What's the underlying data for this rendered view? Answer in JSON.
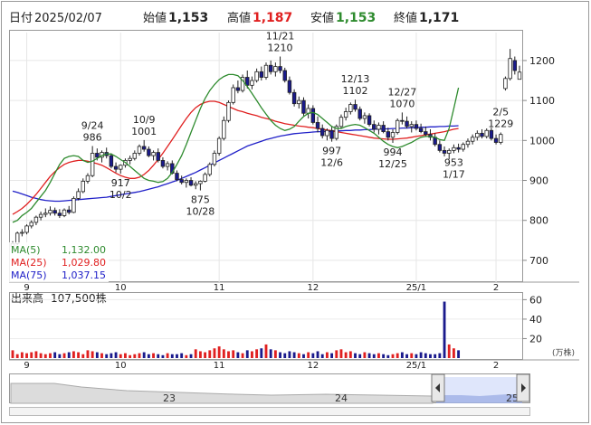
{
  "header": {
    "date_label": "日付",
    "date": "2025/02/07",
    "open_label": "始値",
    "open": "1,153",
    "high_label": "高値",
    "high": "1,187",
    "low_label": "安値",
    "low": "1,153",
    "close_label": "終値",
    "close": "1,171"
  },
  "colors": {
    "up_candle": "#ffffff",
    "down_candle": "#1a1a8c",
    "ma5": "#2e8b2e",
    "ma25": "#e02020",
    "ma75": "#2020c8",
    "volume_up": "#e02020",
    "volume_down": "#1a1a8c",
    "high_text": "#e02020",
    "low_text": "#2e8b2e"
  },
  "ma_legend": [
    {
      "label": "MA(5)",
      "value": "1,132.00",
      "color": "#2e8b2e"
    },
    {
      "label": "MA(25)",
      "value": "1,029.80",
      "color": "#e02020"
    },
    {
      "label": "MA(75)",
      "value": "1,037.15",
      "color": "#2020c8"
    }
  ],
  "volume_label": "出来高",
  "volume_value": "107,500株",
  "volume_unit": "(万株)",
  "annotations": [
    {
      "date": "9/24",
      "price": "986"
    },
    {
      "date": "10/9",
      "price": "1001"
    },
    {
      "date": "10/2",
      "price": "917"
    },
    {
      "date": "10/28",
      "price": "875"
    },
    {
      "date": "11/21",
      "price": "1210"
    },
    {
      "date": "12/6",
      "price": "997"
    },
    {
      "date": "12/13",
      "price": "1102"
    },
    {
      "date": "12/25",
      "price": "994"
    },
    {
      "date": "12/27",
      "price": "1070"
    },
    {
      "date": "1/17",
      "price": "953"
    },
    {
      "date": "2/5",
      "price": "1229"
    }
  ],
  "navigator": {
    "labels": [
      "23",
      "24",
      "25"
    ],
    "left_handle": "left-arrow",
    "right_handle": "right-arrow"
  },
  "chart_data": {
    "type": "candlestick",
    "x_tick_labels": [
      "9",
      "10",
      "11",
      "12",
      "25/1",
      "2"
    ],
    "price_ticks": [
      700,
      800,
      900,
      1000,
      1100,
      1200
    ],
    "price_range": [
      650,
      1270
    ],
    "volume_ticks": [
      20,
      40,
      60
    ],
    "volume_range": [
      0,
      65
    ],
    "candles": [
      {
        "d": "8/28",
        "o": 735,
        "h": 748,
        "l": 720,
        "c": 742
      },
      {
        "d": "8/29",
        "o": 742,
        "h": 772,
        "l": 738,
        "c": 768
      },
      {
        "d": "8/30",
        "o": 768,
        "h": 778,
        "l": 760,
        "c": 770
      },
      {
        "d": "9/2",
        "o": 770,
        "h": 790,
        "l": 765,
        "c": 786
      },
      {
        "d": "9/3",
        "o": 786,
        "h": 800,
        "l": 780,
        "c": 795
      },
      {
        "d": "9/4",
        "o": 795,
        "h": 812,
        "l": 788,
        "c": 808
      },
      {
        "d": "9/5",
        "o": 808,
        "h": 822,
        "l": 800,
        "c": 815
      },
      {
        "d": "9/6",
        "o": 815,
        "h": 830,
        "l": 808,
        "c": 818
      },
      {
        "d": "9/9",
        "o": 818,
        "h": 835,
        "l": 812,
        "c": 825
      },
      {
        "d": "9/10",
        "o": 825,
        "h": 832,
        "l": 812,
        "c": 818
      },
      {
        "d": "9/11",
        "o": 818,
        "h": 828,
        "l": 806,
        "c": 812
      },
      {
        "d": "9/12",
        "o": 812,
        "h": 830,
        "l": 808,
        "c": 826
      },
      {
        "d": "9/13",
        "o": 826,
        "h": 836,
        "l": 815,
        "c": 820
      },
      {
        "d": "9/17",
        "o": 820,
        "h": 860,
        "l": 818,
        "c": 855
      },
      {
        "d": "9/18",
        "o": 855,
        "h": 880,
        "l": 850,
        "c": 872
      },
      {
        "d": "9/19",
        "o": 872,
        "h": 905,
        "l": 868,
        "c": 898
      },
      {
        "d": "9/20",
        "o": 898,
        "h": 918,
        "l": 892,
        "c": 912
      },
      {
        "d": "9/24",
        "o": 912,
        "h": 986,
        "l": 908,
        "c": 968
      },
      {
        "d": "9/25",
        "o": 968,
        "h": 980,
        "l": 950,
        "c": 958
      },
      {
        "d": "9/26",
        "o": 958,
        "h": 975,
        "l": 945,
        "c": 970
      },
      {
        "d": "9/27",
        "o": 970,
        "h": 982,
        "l": 955,
        "c": 962
      },
      {
        "d": "9/30",
        "o": 962,
        "h": 968,
        "l": 930,
        "c": 935
      },
      {
        "d": "10/1",
        "o": 935,
        "h": 945,
        "l": 920,
        "c": 928
      },
      {
        "d": "10/2",
        "o": 928,
        "h": 940,
        "l": 917,
        "c": 938
      },
      {
        "d": "10/3",
        "o": 938,
        "h": 955,
        "l": 932,
        "c": 950
      },
      {
        "d": "10/4",
        "o": 950,
        "h": 962,
        "l": 940,
        "c": 955
      },
      {
        "d": "10/7",
        "o": 955,
        "h": 975,
        "l": 950,
        "c": 968
      },
      {
        "d": "10/8",
        "o": 968,
        "h": 990,
        "l": 962,
        "c": 985
      },
      {
        "d": "10/9",
        "o": 985,
        "h": 1001,
        "l": 972,
        "c": 978
      },
      {
        "d": "10/10",
        "o": 978,
        "h": 985,
        "l": 958,
        "c": 962
      },
      {
        "d": "10/11",
        "o": 962,
        "h": 975,
        "l": 950,
        "c": 970
      },
      {
        "d": "10/15",
        "o": 970,
        "h": 980,
        "l": 945,
        "c": 950
      },
      {
        "d": "10/16",
        "o": 950,
        "h": 958,
        "l": 930,
        "c": 935
      },
      {
        "d": "10/17",
        "o": 935,
        "h": 948,
        "l": 925,
        "c": 942
      },
      {
        "d": "10/18",
        "o": 942,
        "h": 950,
        "l": 915,
        "c": 918
      },
      {
        "d": "10/21",
        "o": 918,
        "h": 925,
        "l": 898,
        "c": 902
      },
      {
        "d": "10/22",
        "o": 902,
        "h": 912,
        "l": 890,
        "c": 895
      },
      {
        "d": "10/23",
        "o": 895,
        "h": 905,
        "l": 882,
        "c": 900
      },
      {
        "d": "10/24",
        "o": 900,
        "h": 908,
        "l": 885,
        "c": 888
      },
      {
        "d": "10/25",
        "o": 888,
        "h": 898,
        "l": 878,
        "c": 892
      },
      {
        "d": "10/28",
        "o": 892,
        "h": 900,
        "l": 875,
        "c": 898
      },
      {
        "d": "10/29",
        "o": 898,
        "h": 920,
        "l": 895,
        "c": 915
      },
      {
        "d": "10/30",
        "o": 915,
        "h": 945,
        "l": 910,
        "c": 940
      },
      {
        "d": "10/31",
        "o": 940,
        "h": 975,
        "l": 935,
        "c": 968
      },
      {
        "d": "11/1",
        "o": 968,
        "h": 1010,
        "l": 962,
        "c": 1005
      },
      {
        "d": "11/5",
        "o": 1005,
        "h": 1060,
        "l": 1000,
        "c": 1050
      },
      {
        "d": "11/6",
        "o": 1050,
        "h": 1100,
        "l": 1045,
        "c": 1095
      },
      {
        "d": "11/7",
        "o": 1095,
        "h": 1140,
        "l": 1090,
        "c": 1132
      },
      {
        "d": "11/8",
        "o": 1132,
        "h": 1150,
        "l": 1118,
        "c": 1125
      },
      {
        "d": "11/11",
        "o": 1125,
        "h": 1165,
        "l": 1120,
        "c": 1158
      },
      {
        "d": "11/12",
        "o": 1158,
        "h": 1175,
        "l": 1130,
        "c": 1138
      },
      {
        "d": "11/13",
        "o": 1138,
        "h": 1160,
        "l": 1128,
        "c": 1150
      },
      {
        "d": "11/14",
        "o": 1150,
        "h": 1180,
        "l": 1145,
        "c": 1172
      },
      {
        "d": "11/15",
        "o": 1172,
        "h": 1185,
        "l": 1150,
        "c": 1158
      },
      {
        "d": "11/18",
        "o": 1158,
        "h": 1195,
        "l": 1152,
        "c": 1188
      },
      {
        "d": "11/19",
        "o": 1188,
        "h": 1200,
        "l": 1165,
        "c": 1172
      },
      {
        "d": "11/20",
        "o": 1172,
        "h": 1195,
        "l": 1160,
        "c": 1185
      },
      {
        "d": "11/21",
        "o": 1185,
        "h": 1210,
        "l": 1168,
        "c": 1175
      },
      {
        "d": "11/22",
        "o": 1175,
        "h": 1182,
        "l": 1145,
        "c": 1150
      },
      {
        "d": "11/25",
        "o": 1150,
        "h": 1160,
        "l": 1115,
        "c": 1120
      },
      {
        "d": "11/26",
        "o": 1120,
        "h": 1128,
        "l": 1085,
        "c": 1092
      },
      {
        "d": "11/27",
        "o": 1092,
        "h": 1110,
        "l": 1080,
        "c": 1100
      },
      {
        "d": "11/28",
        "o": 1100,
        "h": 1108,
        "l": 1062,
        "c": 1068
      },
      {
        "d": "11/29",
        "o": 1068,
        "h": 1090,
        "l": 1055,
        "c": 1080
      },
      {
        "d": "12/2",
        "o": 1080,
        "h": 1088,
        "l": 1040,
        "c": 1045
      },
      {
        "d": "12/3",
        "o": 1045,
        "h": 1060,
        "l": 1020,
        "c": 1030
      },
      {
        "d": "12/4",
        "o": 1030,
        "h": 1040,
        "l": 1005,
        "c": 1012
      },
      {
        "d": "12/5",
        "o": 1012,
        "h": 1030,
        "l": 1000,
        "c": 1025
      },
      {
        "d": "12/6",
        "o": 1025,
        "h": 1035,
        "l": 997,
        "c": 1005
      },
      {
        "d": "12/9",
        "o": 1005,
        "h": 1040,
        "l": 1000,
        "c": 1035
      },
      {
        "d": "12/10",
        "o": 1035,
        "h": 1065,
        "l": 1030,
        "c": 1058
      },
      {
        "d": "12/11",
        "o": 1058,
        "h": 1082,
        "l": 1050,
        "c": 1072
      },
      {
        "d": "12/12",
        "o": 1072,
        "h": 1095,
        "l": 1065,
        "c": 1090
      },
      {
        "d": "12/13",
        "o": 1090,
        "h": 1102,
        "l": 1072,
        "c": 1078
      },
      {
        "d": "12/16",
        "o": 1078,
        "h": 1085,
        "l": 1050,
        "c": 1055
      },
      {
        "d": "12/17",
        "o": 1055,
        "h": 1070,
        "l": 1042,
        "c": 1062
      },
      {
        "d": "12/18",
        "o": 1062,
        "h": 1068,
        "l": 1035,
        "c": 1040
      },
      {
        "d": "12/19",
        "o": 1040,
        "h": 1050,
        "l": 1020,
        "c": 1028
      },
      {
        "d": "12/20",
        "o": 1028,
        "h": 1045,
        "l": 1015,
        "c": 1038
      },
      {
        "d": "12/23",
        "o": 1038,
        "h": 1048,
        "l": 1018,
        "c": 1022
      },
      {
        "d": "12/24",
        "o": 1022,
        "h": 1032,
        "l": 1000,
        "c": 1008
      },
      {
        "d": "12/25",
        "o": 1008,
        "h": 1028,
        "l": 994,
        "c": 1020
      },
      {
        "d": "12/26",
        "o": 1020,
        "h": 1055,
        "l": 1015,
        "c": 1050
      },
      {
        "d": "12/27",
        "o": 1050,
        "h": 1070,
        "l": 1040,
        "c": 1048
      },
      {
        "d": "12/30",
        "o": 1048,
        "h": 1060,
        "l": 1030,
        "c": 1035
      },
      {
        "d": "1/6",
        "o": 1035,
        "h": 1048,
        "l": 1020,
        "c": 1040
      },
      {
        "d": "1/7",
        "o": 1040,
        "h": 1050,
        "l": 1025,
        "c": 1030
      },
      {
        "d": "1/8",
        "o": 1030,
        "h": 1042,
        "l": 1018,
        "c": 1022
      },
      {
        "d": "1/9",
        "o": 1022,
        "h": 1035,
        "l": 1010,
        "c": 1015
      },
      {
        "d": "1/10",
        "o": 1015,
        "h": 1028,
        "l": 1000,
        "c": 1008
      },
      {
        "d": "1/14",
        "o": 1008,
        "h": 1018,
        "l": 985,
        "c": 990
      },
      {
        "d": "1/15",
        "o": 990,
        "h": 1000,
        "l": 970,
        "c": 975
      },
      {
        "d": "1/16",
        "o": 975,
        "h": 985,
        "l": 960,
        "c": 968
      },
      {
        "d": "1/17",
        "o": 968,
        "h": 980,
        "l": 953,
        "c": 975
      },
      {
        "d": "1/20",
        "o": 975,
        "h": 990,
        "l": 968,
        "c": 982
      },
      {
        "d": "1/21",
        "o": 982,
        "h": 992,
        "l": 970,
        "c": 978
      },
      {
        "d": "1/22",
        "o": 978,
        "h": 995,
        "l": 972,
        "c": 990
      },
      {
        "d": "1/23",
        "o": 990,
        "h": 1005,
        "l": 982,
        "c": 998
      },
      {
        "d": "1/24",
        "o": 998,
        "h": 1015,
        "l": 990,
        "c": 1008
      },
      {
        "d": "1/27",
        "o": 1008,
        "h": 1025,
        "l": 1000,
        "c": 1018
      },
      {
        "d": "1/28",
        "o": 1018,
        "h": 1028,
        "l": 1005,
        "c": 1010
      },
      {
        "d": "1/29",
        "o": 1010,
        "h": 1030,
        "l": 1005,
        "c": 1025
      },
      {
        "d": "1/30",
        "o": 1025,
        "h": 1032,
        "l": 1000,
        "c": 1005
      },
      {
        "d": "1/31",
        "o": 1005,
        "h": 1015,
        "l": 990,
        "c": 995
      },
      {
        "d": "2/3",
        "o": 995,
        "h": 1020,
        "l": 990,
        "c": 1015
      },
      {
        "d": "2/4",
        "o": 1130,
        "h": 1160,
        "l": 1125,
        "c": 1155
      },
      {
        "d": "2/5",
        "o": 1155,
        "h": 1229,
        "l": 1150,
        "c": 1205
      },
      {
        "d": "2/6",
        "o": 1200,
        "h": 1210,
        "l": 1165,
        "c": 1175
      },
      {
        "d": "2/7",
        "o": 1153,
        "h": 1187,
        "l": 1153,
        "c": 1171
      }
    ],
    "ma5": [
      795,
      800,
      812,
      820,
      830,
      845,
      860,
      875,
      895,
      918,
      940,
      955,
      960,
      962,
      960,
      950,
      945,
      948,
      955,
      962,
      966,
      966,
      960,
      952,
      945,
      935,
      925,
      915,
      905,
      900,
      898,
      895,
      897,
      905,
      920,
      940,
      962,
      990,
      1020,
      1050,
      1080,
      1105,
      1125,
      1140,
      1152,
      1160,
      1165,
      1165,
      1162,
      1150,
      1135,
      1118,
      1100,
      1082,
      1066,
      1050,
      1038,
      1030,
      1025,
      1028,
      1035,
      1048,
      1060,
      1068,
      1070,
      1065,
      1055,
      1045,
      1035,
      1030,
      1030,
      1035,
      1038,
      1040,
      1038,
      1032,
      1025,
      1018,
      1008,
      998,
      990,
      985,
      982,
      985,
      990,
      995,
      1002,
      1008,
      1010,
      1010,
      1008,
      1002,
      1000,
      1030,
      1080,
      1132
    ],
    "ma25": [
      815,
      822,
      830,
      840,
      852,
      865,
      880,
      895,
      910,
      922,
      932,
      940,
      945,
      948,
      950,
      950,
      948,
      945,
      942,
      938,
      932,
      925,
      918,
      912,
      908,
      905,
      905,
      908,
      915,
      925,
      938,
      952,
      968,
      985,
      1002,
      1020,
      1038,
      1055,
      1070,
      1082,
      1090,
      1095,
      1098,
      1098,
      1095,
      1090,
      1085,
      1080,
      1075,
      1072,
      1068,
      1065,
      1062,
      1058,
      1055,
      1052,
      1048,
      1045,
      1042,
      1040,
      1038,
      1036,
      1035,
      1033,
      1032,
      1030,
      1028,
      1026,
      1024,
      1022,
      1020,
      1018,
      1016,
      1014,
      1012,
      1010,
      1008,
      1006,
      1005,
      1004,
      1003,
      1003,
      1004,
      1005,
      1006,
      1008,
      1010,
      1012,
      1014,
      1016,
      1018,
      1020,
      1022,
      1025,
      1028,
      1030
    ],
    "ma75": [
      873,
      870,
      866,
      862,
      858,
      855,
      852,
      850,
      849,
      848,
      848,
      849,
      850,
      851,
      852,
      853,
      854,
      855,
      856,
      857,
      858,
      860,
      862,
      864,
      866,
      868,
      870,
      872,
      875,
      878,
      881,
      884,
      888,
      892,
      896,
      900,
      905,
      910,
      915,
      920,
      926,
      932,
      938,
      944,
      950,
      956,
      962,
      968,
      974,
      980,
      986,
      990,
      994,
      998,
      1002,
      1005,
      1008,
      1011,
      1013,
      1015,
      1017,
      1018,
      1019,
      1020,
      1021,
      1022,
      1022,
      1023,
      1023,
      1024,
      1024,
      1025,
      1025,
      1026,
      1026,
      1027,
      1027,
      1028,
      1028,
      1029,
      1029,
      1030,
      1030,
      1031,
      1031,
      1032,
      1032,
      1033,
      1033,
      1034,
      1034,
      1035,
      1035,
      1036,
      1036,
      1037
    ],
    "volumes": [
      8,
      4,
      6,
      5,
      6,
      7,
      5,
      4,
      5,
      6,
      4,
      5,
      6,
      7,
      6,
      4,
      8,
      7,
      6,
      5,
      4,
      5,
      6,
      4,
      5,
      3,
      4,
      5,
      6,
      4,
      5,
      4,
      3,
      5,
      4,
      4,
      5,
      3,
      4,
      9,
      7,
      6,
      8,
      10,
      12,
      9,
      7,
      8,
      6,
      5,
      8,
      7,
      9,
      10,
      14,
      9,
      8,
      6,
      5,
      7,
      6,
      5,
      4,
      6,
      5,
      7,
      4,
      6,
      5,
      8,
      9,
      6,
      7,
      5,
      4,
      6,
      5,
      4,
      5,
      4,
      3,
      4,
      5,
      6,
      4,
      5,
      4,
      6,
      5,
      4,
      4,
      5,
      58,
      14,
      10,
      8
    ]
  }
}
